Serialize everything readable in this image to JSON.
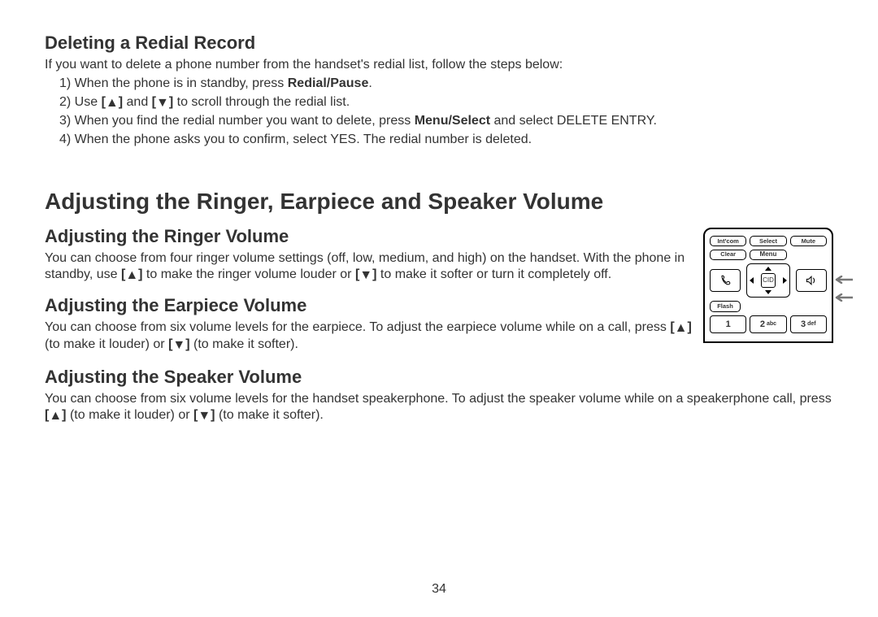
{
  "page_number": "34",
  "icons": {
    "up": "▲",
    "down": "▼"
  },
  "section1": {
    "heading": "Deleting a Redial Record",
    "intro": "If you want to delete a phone number from the handset's redial list, follow the steps below:",
    "s1_a": "1) When the phone is in standby, press ",
    "s1_b": "Redial/Pause",
    "s1_c": ".",
    "s2_a": "2) Use ",
    "s2_b": " and ",
    "s2_c": " to scroll through the redial list.",
    "s3_a": "3) When you find the redial number you want to delete, press ",
    "s3_b": "Menu/Select",
    "s3_c": " and select DELETE ENTRY.",
    "s4": "4) When the phone asks you to confirm, select YES. The redial number is deleted."
  },
  "section2": {
    "heading": "Adjusting the Ringer, Earpiece and Speaker Volume",
    "ringer_heading": "Adjusting the Ringer Volume",
    "ringer_a": "You can choose from four ringer volume settings (off, low, medium, and high) on the handset. With the phone in standby, use ",
    "ringer_b": " to make the ringer volume louder or ",
    "ringer_c": " to make it softer or turn it completely off.",
    "earpiece_heading": "Adjusting the Earpiece Volume",
    "earpiece_a": "You can choose from six volume levels for the earpiece. To adjust the earpiece volume while on a call, press ",
    "earpiece_b": " (to make it louder) or ",
    "earpiece_c": " (to make it softer).",
    "speaker_heading": "Adjusting the Speaker Volume",
    "speaker_a": "You can choose from six volume levels for the handset speakerphone. To adjust the speaker volume while on a speakerphone call, press ",
    "speaker_b": " (to make it louder) or ",
    "speaker_c": " (to make it softer)."
  },
  "phone": {
    "intcom": "Int'com",
    "select": "Select",
    "mute": "Mute",
    "clear": "Clear",
    "menu": "Menu",
    "flash": "Flash",
    "cid": "CID",
    "k1": "1",
    "k2": "2",
    "k2s": "abc",
    "k3": "3",
    "k3s": "def"
  }
}
